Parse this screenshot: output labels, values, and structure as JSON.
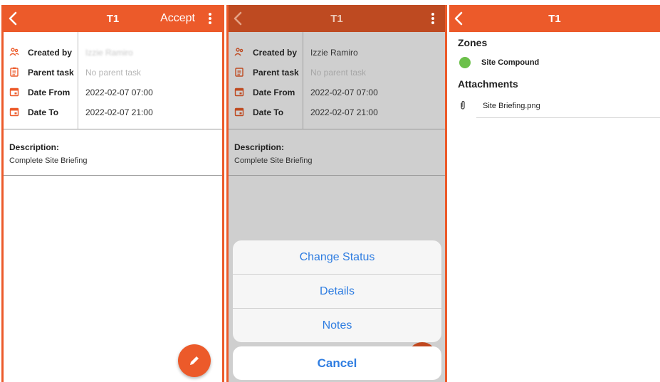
{
  "panel1": {
    "header": {
      "title": "T1",
      "accept_label": "Accept"
    },
    "fields": [
      {
        "label": "Created by",
        "value": "Izzie Ramiro",
        "icon": "people-icon"
      },
      {
        "label": "Parent task",
        "value": "No parent task",
        "icon": "clipboard-icon"
      },
      {
        "label": "Date From",
        "value": "2022-02-07 07:00",
        "icon": "calendar-icon"
      },
      {
        "label": "Date To",
        "value": "2022-02-07 21:00",
        "icon": "calendar-icon"
      }
    ],
    "description": {
      "heading": "Description:",
      "text": "Complete Site Briefing"
    }
  },
  "panel2": {
    "header": {
      "title": "T1"
    },
    "fields": [
      {
        "label": "Created by",
        "value": "Izzie Ramiro"
      },
      {
        "label": "Parent task",
        "value": "No parent task"
      },
      {
        "label": "Date From",
        "value": "2022-02-07 07:00"
      },
      {
        "label": "Date To",
        "value": "2022-02-07 21:00"
      }
    ],
    "description": {
      "heading": "Description:",
      "text": "Complete Site Briefing"
    },
    "action_sheet": {
      "items": [
        "Change Status",
        "Details",
        "Notes"
      ],
      "cancel": "Cancel"
    }
  },
  "panel3": {
    "header": {
      "title": "T1"
    },
    "zones_heading": "Zones",
    "zone": {
      "name": "Site Compound",
      "color": "#6cc04a"
    },
    "attachments_heading": "Attachments",
    "attachment": {
      "name": "Site Briefing.png"
    }
  },
  "colors": {
    "accent": "#ec5a2a",
    "link": "#2f7de1"
  }
}
